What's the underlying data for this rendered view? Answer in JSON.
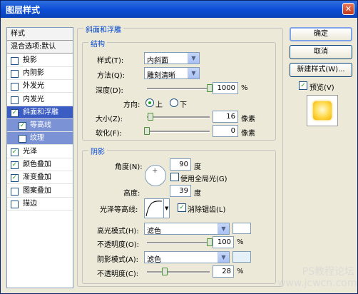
{
  "window": {
    "title": "图层样式"
  },
  "styles_list": [
    {
      "label": "样式",
      "kind": "header"
    },
    {
      "label": "混合选项:默认",
      "kind": "header2"
    },
    {
      "label": "投影",
      "checked": false
    },
    {
      "label": "内阴影",
      "checked": false
    },
    {
      "label": "外发光",
      "checked": false
    },
    {
      "label": "内发光",
      "checked": false
    },
    {
      "label": "斜面和浮雕",
      "checked": true,
      "selected": true
    },
    {
      "label": "等高线",
      "checked": true,
      "sub": true
    },
    {
      "label": "纹理",
      "checked": false,
      "sub": true
    },
    {
      "label": "光泽",
      "checked": true
    },
    {
      "label": "颜色叠加",
      "checked": true
    },
    {
      "label": "渐变叠加",
      "checked": true
    },
    {
      "label": "图案叠加",
      "checked": false
    },
    {
      "label": "描边",
      "checked": false
    }
  ],
  "bevel": {
    "group_title": "斜面和浮雕",
    "structure_title": "结构",
    "style_label": "样式(T):",
    "style_value": "内斜面",
    "method_label": "方法(Q):",
    "method_value": "雕刻清晰",
    "depth_label": "深度(D):",
    "depth_value": "1000",
    "depth_unit": "%",
    "depth_level": 1.0,
    "direction_label": "方向:",
    "direction_up": "上",
    "direction_down": "下",
    "size_label": "大小(Z):",
    "size_value": "16",
    "size_unit": "像素",
    "size_level": 0.06,
    "soften_label": "软化(F):",
    "soften_value": "0",
    "soften_unit": "像素",
    "soften_level": 0.0
  },
  "shading": {
    "title": "阴影",
    "angle_label": "角度(N):",
    "angle_value": "90",
    "angle_unit": "度",
    "global_light_label": "使用全局光(G)",
    "global_light_checked": false,
    "altitude_label": "高度:",
    "altitude_value": "39",
    "altitude_unit": "度",
    "gloss_contour_label": "光泽等高线:",
    "antialias_label": "消除锯齿(L)",
    "antialias_checked": true,
    "highlight_mode_label": "高光模式(H):",
    "highlight_mode_value": "滤色",
    "highlight_color": "#ffffff",
    "highlight_opacity_label": "不透明度(O):",
    "highlight_opacity_value": "100",
    "highlight_opacity_unit": "%",
    "highlight_opacity_level": 1.0,
    "shadow_mode_label": "阴影模式(A):",
    "shadow_mode_value": "滤色",
    "shadow_color": "#e6f0f8",
    "shadow_opacity_label": "不透明度(C):",
    "shadow_opacity_value": "28",
    "shadow_opacity_unit": "%",
    "shadow_opacity_level": 0.28
  },
  "buttons": {
    "ok": "确定",
    "cancel": "取消",
    "new_style": "新建样式(W)...",
    "preview_label": "预览(V)",
    "preview_checked": true
  },
  "watermark": "PS教程论坛 www.jcwcn.com"
}
